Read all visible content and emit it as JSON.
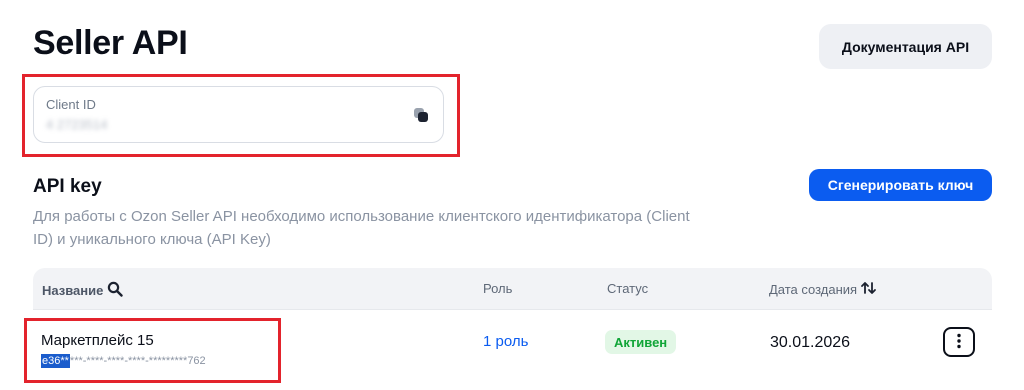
{
  "header": {
    "title": "Seller API",
    "docs_button": "Документация API"
  },
  "client_id": {
    "label": "Client ID",
    "value": "4 2723514",
    "copy_icon": "copy-icon"
  },
  "api_key": {
    "title": "API key",
    "generate_button": "Сгенерировать ключ",
    "description": "Для работы с Ozon Seller API необходимо использование клиентского идентификатора (Client ID) и уникального ключа (API Key)"
  },
  "table": {
    "columns": {
      "name": "Название",
      "role": "Роль",
      "status": "Статус",
      "created": "Дата создания"
    },
    "rows": [
      {
        "name": "Маркетплейс 15",
        "key_selected": "e36**",
        "key_rest": "***-****-****-****-*********762",
        "role": "1 роль",
        "status": "Активен",
        "created": "30.01.2026"
      }
    ]
  },
  "colors": {
    "accent": "#0b5cf0",
    "status_active_bg": "#e2f7e6",
    "status_active_text": "#10a537",
    "highlight_outline": "#e3232c"
  }
}
